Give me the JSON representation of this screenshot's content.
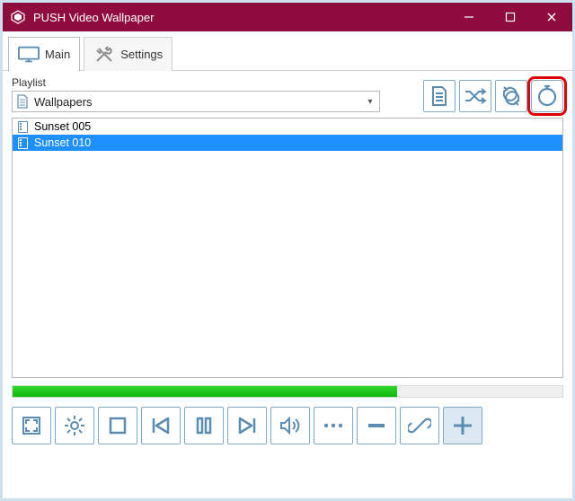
{
  "window": {
    "title": "PUSH Video Wallpaper"
  },
  "tabs": {
    "main": "Main",
    "settings": "Settings"
  },
  "playlist": {
    "label": "Playlist",
    "selected": "Wallpapers",
    "items": [
      {
        "name": "Sunset 005",
        "selected": false
      },
      {
        "name": "Sunset 010",
        "selected": true
      }
    ]
  },
  "progress_percent": 70,
  "icons": {
    "new_playlist": "new-playlist-icon",
    "shuffle": "shuffle-icon",
    "loop": "loop-icon",
    "interval": "interval-icon",
    "fullscreen": "fullscreen-icon",
    "gear": "gear-icon",
    "stop": "stop-icon",
    "prev": "prev-icon",
    "pause": "pause-icon",
    "next": "next-icon",
    "volume": "volume-icon",
    "more": "more-icon",
    "remove": "remove-icon",
    "link": "link-icon",
    "add": "add-icon"
  }
}
